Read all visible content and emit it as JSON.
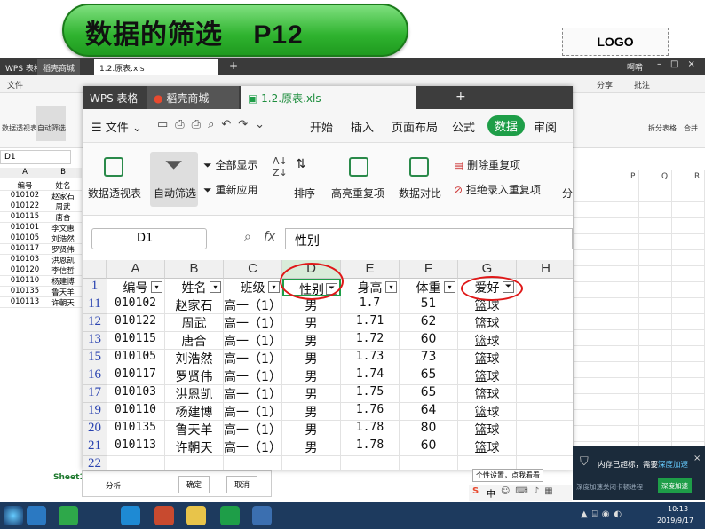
{
  "slide": {
    "title": "数据的筛选",
    "page": "P12",
    "logo": "LOGO"
  },
  "background_window": {
    "tabs": [
      "WPS 表格",
      "稻壳商城",
      "1.2.原表.xls"
    ],
    "menu_file": "文件",
    "ribbon_labels": [
      "数据透视表",
      "自动筛选"
    ],
    "toolbar_right": [
      "分享",
      "批注"
    ],
    "ribbon_right": [
      "拆分表格",
      "合并"
    ],
    "cell_ref": "D1",
    "col_headers": [
      "A",
      "B"
    ],
    "rows": [
      [
        "编号",
        "姓名"
      ],
      [
        "010102",
        "赵家石"
      ],
      [
        "010122",
        "周武"
      ],
      [
        "010115",
        "唐合"
      ],
      [
        "010101",
        "李文惠"
      ],
      [
        "010105",
        "刘浩然"
      ],
      [
        "010117",
        "罗贤伟"
      ],
      [
        "010103",
        "洪恩凯"
      ],
      [
        "010120",
        "李信哲"
      ],
      [
        "010110",
        "杨建博"
      ],
      [
        "010135",
        "鲁天羊"
      ],
      [
        "010113",
        "许朝天"
      ]
    ],
    "right_cols": [
      "P",
      "Q",
      "R"
    ],
    "sheet_tab": "Sheet1",
    "dialog_label": "分析",
    "dialog_ok": "确定",
    "dialog_cancel": "取消",
    "user": "啊啃"
  },
  "wps": {
    "tabs": {
      "app": "WPS 表格",
      "store": "稻壳商城",
      "file": "1.2.原表.xls"
    },
    "menu": {
      "file": "文件",
      "start": "开始",
      "insert": "插入",
      "layout": "页面布局",
      "formula": "公式",
      "data": "数据",
      "review": "审阅"
    },
    "ribbon": {
      "pivot": "数据透视表",
      "autofilter": "自动筛选",
      "show_all": "全部显示",
      "reapply": "重新应用",
      "sort": "排序",
      "highlight_dup": "高亮重复项",
      "compare": "数据对比",
      "remove_dup": "删除重复项",
      "reject_dup": "拒绝录入重复项",
      "split": "分"
    },
    "name_box": "D1",
    "fx_label": "fx",
    "formula_value": "性别",
    "columns": [
      "A",
      "B",
      "C",
      "D",
      "E",
      "F",
      "G",
      "H"
    ],
    "header_row": {
      "num": "1",
      "cells": [
        "编号",
        "姓名",
        "班级",
        "性别",
        "身高",
        "体重",
        "爱好"
      ]
    },
    "rows": [
      {
        "num": "11",
        "cells": [
          "010102",
          "赵家石",
          "高一（1）",
          "男",
          "1.7",
          "51",
          "篮球"
        ]
      },
      {
        "num": "12",
        "cells": [
          "010122",
          "周武",
          "高一（1）",
          "男",
          "1.71",
          "62",
          "篮球"
        ]
      },
      {
        "num": "13",
        "cells": [
          "010115",
          "唐合",
          "高一（1）",
          "男",
          "1.72",
          "60",
          "篮球"
        ]
      },
      {
        "num": "15",
        "cells": [
          "010105",
          "刘浩然",
          "高一（1）",
          "男",
          "1.73",
          "73",
          "篮球"
        ]
      },
      {
        "num": "16",
        "cells": [
          "010117",
          "罗贤伟",
          "高一（1）",
          "男",
          "1.74",
          "65",
          "篮球"
        ]
      },
      {
        "num": "17",
        "cells": [
          "010103",
          "洪恩凯",
          "高一（1）",
          "男",
          "1.75",
          "65",
          "篮球"
        ]
      },
      {
        "num": "19",
        "cells": [
          "010110",
          "杨建博",
          "高一（1）",
          "男",
          "1.76",
          "64",
          "篮球"
        ]
      },
      {
        "num": "20",
        "cells": [
          "010135",
          "鲁天羊",
          "高一（1）",
          "男",
          "1.78",
          "80",
          "篮球"
        ]
      },
      {
        "num": "21",
        "cells": [
          "010113",
          "许朝天",
          "高一（1）",
          "男",
          "1.78",
          "60",
          "篮球"
        ]
      },
      {
        "num": "22",
        "cells": [
          "",
          "",
          "",
          "",
          "",
          "",
          ""
        ]
      }
    ]
  },
  "notification": {
    "text": "内存已超标，需要",
    "action": "深度加速",
    "sub": "深度加速关闭卡顿进程",
    "button": "深度加速",
    "tooltip": "个性设置，点我看看"
  },
  "taskbar": {
    "time": "10:13",
    "date": "2019/9/17",
    "ime": "中"
  },
  "colors": {
    "accent_green": "#1e9e48",
    "title_pill": "#2fb32f",
    "annotation_red": "#e01818",
    "row_number_blue": "#2a43b0"
  }
}
